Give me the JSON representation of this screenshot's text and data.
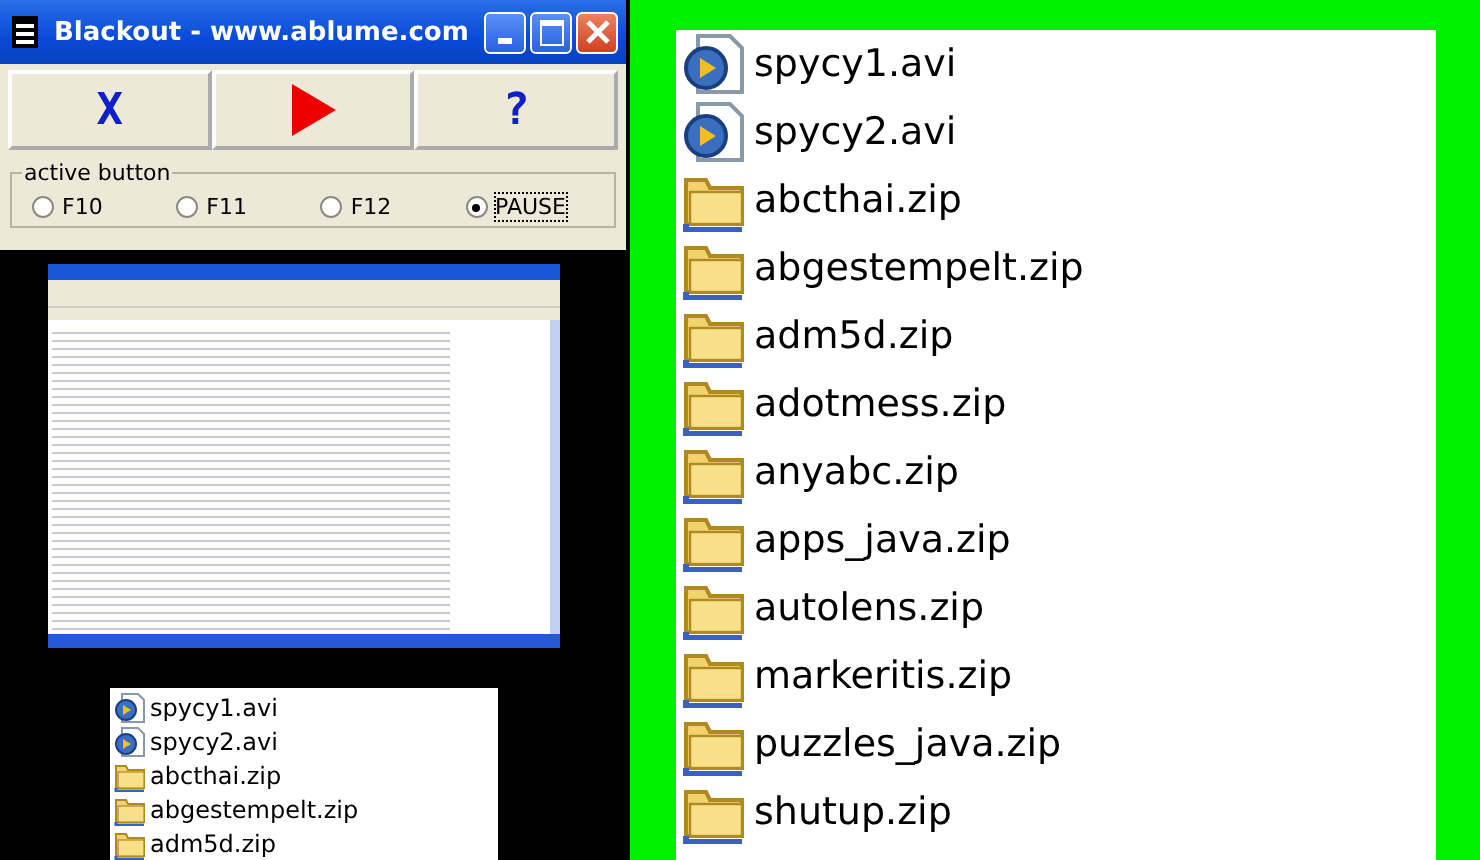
{
  "window": {
    "title": "Blackout  -  www.ablume.com"
  },
  "toolbar": [
    {
      "kind": "text",
      "label": "X"
    },
    {
      "kind": "play"
    },
    {
      "kind": "text",
      "label": "?"
    }
  ],
  "active_button": {
    "label": "active button",
    "options": [
      {
        "label": "F10",
        "selected": false
      },
      {
        "label": "F11",
        "selected": false
      },
      {
        "label": "F12",
        "selected": false
      },
      {
        "label": "PAUSE",
        "selected": true
      }
    ]
  },
  "small_list": [
    {
      "kind": "video",
      "name": "spycy1.avi"
    },
    {
      "kind": "video",
      "name": "spycy2.avi"
    },
    {
      "kind": "zip",
      "name": "abcthai.zip"
    },
    {
      "kind": "zip",
      "name": "abgestempelt.zip"
    },
    {
      "kind": "zip",
      "name": "adm5d.zip"
    }
  ],
  "large_list": [
    {
      "kind": "video",
      "name": "spycy1.avi"
    },
    {
      "kind": "video",
      "name": "spycy2.avi"
    },
    {
      "kind": "zip",
      "name": "abcthai.zip"
    },
    {
      "kind": "zip",
      "name": "abgestempelt.zip"
    },
    {
      "kind": "zip",
      "name": "adm5d.zip"
    },
    {
      "kind": "zip",
      "name": "adotmess.zip"
    },
    {
      "kind": "zip",
      "name": "anyabc.zip"
    },
    {
      "kind": "zip",
      "name": "apps_java.zip"
    },
    {
      "kind": "zip",
      "name": "autolens.zip"
    },
    {
      "kind": "zip",
      "name": "markeritis.zip"
    },
    {
      "kind": "zip",
      "name": "puzzles_java.zip"
    },
    {
      "kind": "zip",
      "name": "shutup.zip"
    }
  ]
}
